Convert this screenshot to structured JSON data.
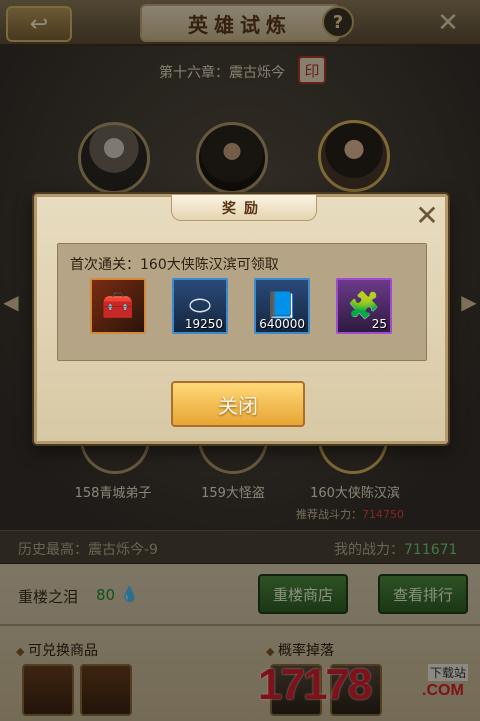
{
  "header": {
    "title": "英雄试炼",
    "help_label": "?"
  },
  "chapter": {
    "label": "第十六章：震古烁今"
  },
  "levels": [
    {
      "label": "158青城弟子"
    },
    {
      "label": "159大怪盗"
    },
    {
      "label": "160大侠陈汉滨"
    }
  ],
  "recommend": {
    "label": "推荐战斗力：",
    "value": "714750"
  },
  "status": {
    "history_label": "历史最高：震古烁今-9",
    "power_label": "我的战力：",
    "power_value": "711671"
  },
  "bottom": {
    "tears_label": "重楼之泪",
    "tears_value": "80",
    "shop_button": "重楼商店",
    "rank_button": "查看排行",
    "exchange_title": "可兑换商品",
    "drop_title": "概率掉落"
  },
  "modal": {
    "title": "奖励",
    "reward_text": "首次通关：160大侠陈汉滨可领取",
    "items": [
      {
        "icon": "treasure-box-icon",
        "count": ""
      },
      {
        "icon": "silver-ingot-icon",
        "count": "19250"
      },
      {
        "icon": "experience-book-icon",
        "count": "640000"
      },
      {
        "icon": "hero-fragment-icon",
        "count": "25"
      }
    ],
    "close_button": "关闭"
  },
  "watermark": {
    "number": "17178",
    "tag": "下载站",
    "domain": ".COM"
  },
  "colors": {
    "power_green": "#6fd07a",
    "recommend_red": "#e5433a",
    "gold_button": "#e7a534",
    "green_button": "#2f6024"
  }
}
